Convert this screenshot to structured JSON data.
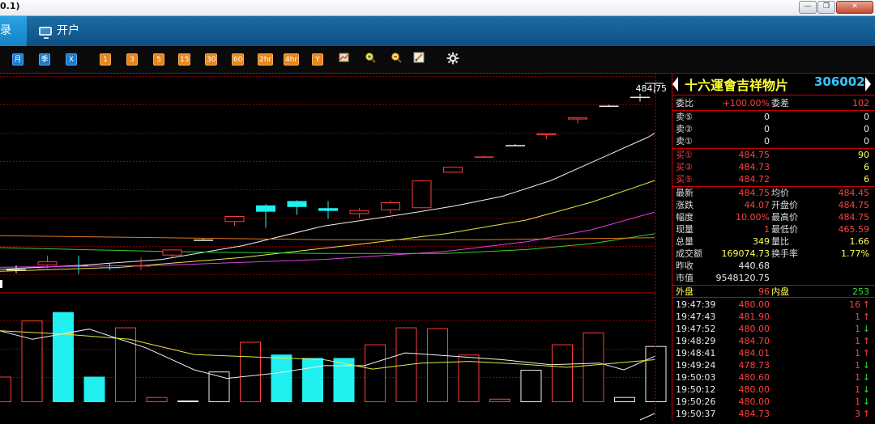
{
  "window": {
    "title_fragment": "0.1)",
    "minimize": "—",
    "restore": "❐",
    "close": "✕"
  },
  "tabs": [
    {
      "label": "录"
    },
    {
      "label": "开户"
    }
  ],
  "toolbar": {
    "period_buttons": [
      {
        "label": "月",
        "style": "blue"
      },
      {
        "label": "季",
        "style": "blue"
      },
      {
        "label": "X",
        "style": "blue"
      },
      {
        "label": "1",
        "style": "orange"
      },
      {
        "label": "3",
        "style": "orange"
      },
      {
        "label": "5",
        "style": "orange"
      },
      {
        "label": "15",
        "style": "orange"
      },
      {
        "label": "30",
        "style": "orange"
      },
      {
        "label": "60",
        "style": "orange"
      },
      {
        "label": "2hr",
        "style": "orange"
      },
      {
        "label": "4hr",
        "style": "orange"
      },
      {
        "label": "Y",
        "style": "orange"
      }
    ],
    "tool_icons": [
      "chart-edit-icon",
      "zoom-in-icon",
      "zoom-out-icon",
      "draw-pen-icon",
      "settings-gear-icon"
    ]
  },
  "stock": {
    "name": "十六運會吉祥物片",
    "code": "306002"
  },
  "quote": {
    "weibi_label": "委比",
    "weibi": "+100.00%",
    "weicha_label": "委差",
    "weicha": "102",
    "asks": [
      {
        "label": "卖⑤",
        "price": "0",
        "vol": "0"
      },
      {
        "label": "卖②",
        "price": "0",
        "vol": "0"
      },
      {
        "label": "卖①",
        "price": "0",
        "vol": "0"
      }
    ],
    "bids": [
      {
        "label": "买①",
        "price": "484.75",
        "vol": "90"
      },
      {
        "label": "买②",
        "price": "484.73",
        "vol": "6"
      },
      {
        "label": "买⑤",
        "price": "484.72",
        "vol": "6"
      }
    ],
    "stats": [
      {
        "l1": "最新",
        "v1": "484.75",
        "l2": "均价",
        "v2": "484.45"
      },
      {
        "l1": "涨跌",
        "v1": "44.07",
        "l2": "开盘价",
        "v2": "484.75"
      },
      {
        "l1": "幅度",
        "v1": "10.00%",
        "l2": "最高价",
        "v2": "484.75"
      },
      {
        "l1": "现量",
        "v1": "1",
        "l2": "最低价",
        "v2": "465.59"
      },
      {
        "l1": "总量",
        "v1": "349",
        "l2": "量比",
        "v2": "1.66"
      },
      {
        "l1": "成交额",
        "v1": "169074.73",
        "l2": "换手率",
        "v2": "1.77%"
      },
      {
        "l1": "昨收",
        "v1": "440.68",
        "l2": "",
        "v2": ""
      },
      {
        "l1": "市值",
        "v1": "9548120.75",
        "l2": "",
        "v2": ""
      }
    ],
    "waipan_label": "外盘",
    "waipan": "96",
    "neipan_label": "内盘",
    "neipan": "253"
  },
  "ticks": [
    {
      "time": "19:47:39",
      "price": "480.00",
      "vol": "16",
      "dir": "↑"
    },
    {
      "time": "19:47:43",
      "price": "481.90",
      "vol": "1",
      "dir": "↑"
    },
    {
      "time": "19:47:52",
      "price": "480.00",
      "vol": "1",
      "dir": "↓"
    },
    {
      "time": "19:48:29",
      "price": "484.70",
      "vol": "1",
      "dir": "↑"
    },
    {
      "time": "19:48:41",
      "price": "484.01",
      "vol": "1",
      "dir": "↑"
    },
    {
      "time": "19:49:24",
      "price": "478.73",
      "vol": "1",
      "dir": "↓"
    },
    {
      "time": "19:50:03",
      "price": "480.60",
      "vol": "1",
      "dir": "↓"
    },
    {
      "time": "19:50:12",
      "price": "480.00",
      "vol": "1",
      "dir": "↓"
    },
    {
      "time": "19:50:26",
      "price": "480.00",
      "vol": "1",
      "dir": "↓"
    },
    {
      "time": "19:50:37",
      "price": "484.73",
      "vol": "3",
      "dir": "↑"
    }
  ],
  "chart_data": {
    "type": "candlestick",
    "price_marker": "484.75",
    "candles": [
      {
        "o": 441,
        "h": 442,
        "l": 440,
        "c": 440.7,
        "color": "white"
      },
      {
        "o": 442,
        "h": 444.5,
        "l": 441.2,
        "c": 443,
        "color": "red"
      },
      {
        "o": 442,
        "h": 444.5,
        "l": 439.8,
        "c": 442,
        "color": "cyan"
      },
      {
        "o": 441.5,
        "h": 442.5,
        "l": 440.8,
        "c": 441.5,
        "color": "cyan"
      },
      {
        "o": 442,
        "h": 444,
        "l": 440.8,
        "c": 442,
        "color": "red"
      },
      {
        "o": 444.5,
        "h": 446,
        "l": 444,
        "c": 446,
        "color": "red"
      },
      {
        "o": 448.5,
        "h": 448.7,
        "l": 448.4,
        "c": 448.5,
        "color": "white"
      },
      {
        "o": 453,
        "h": 454,
        "l": 452,
        "c": 454.5,
        "color": "red"
      },
      {
        "o": 457.2,
        "h": 457.5,
        "l": 451.5,
        "c": 455.6,
        "color": "cyan"
      },
      {
        "o": 458.3,
        "h": 458.5,
        "l": 454.8,
        "c": 456.8,
        "color": "cyan"
      },
      {
        "o": 456.5,
        "h": 458.3,
        "l": 453.8,
        "c": 455.8,
        "color": "cyan"
      },
      {
        "o": 455,
        "h": 456.5,
        "l": 454,
        "c": 456,
        "color": "red"
      },
      {
        "o": 456,
        "h": 458.5,
        "l": 455,
        "c": 458,
        "color": "red"
      },
      {
        "o": 456.5,
        "h": 463.5,
        "l": 456.5,
        "c": 463.5,
        "color": "red"
      },
      {
        "o": 465.5,
        "h": 467,
        "l": 465.5,
        "c": 467,
        "color": "red"
      },
      {
        "o": 469.5,
        "h": 469.8,
        "l": 469.3,
        "c": 469.6,
        "color": "red"
      },
      {
        "o": 472.5,
        "h": 472.7,
        "l": 472.3,
        "c": 472.5,
        "color": "white"
      },
      {
        "o": 475,
        "h": 475.5,
        "l": 474,
        "c": 475.5,
        "color": "red"
      },
      {
        "o": 479,
        "h": 479.5,
        "l": 478,
        "c": 479.5,
        "color": "red"
      },
      {
        "o": 482.5,
        "h": 482.7,
        "l": 482.4,
        "c": 482.5,
        "color": "white"
      },
      {
        "o": 484.5,
        "h": 485.5,
        "l": 483.5,
        "c": 484.75,
        "color": "white"
      }
    ],
    "volumes": [
      {
        "v": 30,
        "color": "red"
      },
      {
        "v": 96,
        "color": "red"
      },
      {
        "v": 106,
        "color": "cyan"
      },
      {
        "v": 30,
        "color": "cyan"
      },
      {
        "v": 88,
        "color": "red"
      },
      {
        "v": 6,
        "color": "red"
      },
      {
        "v": 2,
        "color": "white"
      },
      {
        "v": 36,
        "color": "white"
      },
      {
        "v": 71,
        "color": "red"
      },
      {
        "v": 56,
        "color": "cyan"
      },
      {
        "v": 52,
        "color": "cyan"
      },
      {
        "v": 52,
        "color": "cyan"
      },
      {
        "v": 68,
        "color": "red"
      },
      {
        "v": 88,
        "color": "red"
      },
      {
        "v": 87,
        "color": "red"
      },
      {
        "v": 56,
        "color": "red"
      },
      {
        "v": 4,
        "color": "red"
      },
      {
        "v": 38,
        "color": "white"
      },
      {
        "v": 68,
        "color": "red"
      },
      {
        "v": 82,
        "color": "red"
      },
      {
        "v": 6,
        "color": "white"
      },
      {
        "v": 66,
        "color": "white"
      }
    ],
    "ma_lines": [
      {
        "color": "#f0f0f0",
        "points": [
          [
            0,
            441
          ],
          [
            100,
            442
          ],
          [
            200,
            443.5
          ],
          [
            300,
            447
          ],
          [
            400,
            452
          ],
          [
            500,
            455
          ],
          [
            560,
            457
          ],
          [
            620,
            459.5
          ],
          [
            680,
            463.5
          ],
          [
            740,
            469
          ],
          [
            800,
            474.5
          ],
          [
            808,
            475.5
          ]
        ]
      },
      {
        "color": "#e8e840",
        "points": [
          [
            0,
            440.5
          ],
          [
            150,
            441.5
          ],
          [
            300,
            444
          ],
          [
            450,
            447.5
          ],
          [
            550,
            450
          ],
          [
            650,
            453.5
          ],
          [
            730,
            458
          ],
          [
            808,
            463.5
          ]
        ]
      },
      {
        "color": "#e040e0",
        "points": [
          [
            0,
            441.5
          ],
          [
            200,
            442
          ],
          [
            400,
            443.5
          ],
          [
            550,
            445.5
          ],
          [
            650,
            448
          ],
          [
            730,
            451
          ],
          [
            808,
            455.5
          ]
        ]
      },
      {
        "color": "#30d030",
        "points": [
          [
            0,
            446.5
          ],
          [
            200,
            445.5
          ],
          [
            400,
            445
          ],
          [
            550,
            445
          ],
          [
            650,
            446
          ],
          [
            730,
            447.5
          ],
          [
            808,
            450
          ]
        ]
      },
      {
        "color": "#e07a20",
        "points": [
          [
            0,
            449.5
          ],
          [
            200,
            449
          ],
          [
            400,
            448.5
          ],
          [
            600,
            448.5
          ],
          [
            808,
            449
          ]
        ]
      }
    ],
    "vol_lines": [
      {
        "color": "#f0f0f0",
        "points": [
          [
            0,
            84
          ],
          [
            40,
            74
          ],
          [
            110,
            86
          ],
          [
            180,
            64
          ],
          [
            240,
            38
          ],
          [
            280,
            28
          ],
          [
            340,
            34
          ],
          [
            400,
            43
          ],
          [
            450,
            43
          ],
          [
            500,
            58
          ],
          [
            560,
            54
          ],
          [
            620,
            50
          ],
          [
            680,
            44
          ],
          [
            740,
            46
          ],
          [
            770,
            38
          ],
          [
            808,
            54
          ]
        ]
      },
      {
        "color": "#e8e840",
        "points": [
          [
            0,
            84
          ],
          [
            80,
            80
          ],
          [
            160,
            74
          ],
          [
            240,
            56
          ],
          [
            320,
            53
          ],
          [
            400,
            50
          ],
          [
            460,
            39
          ],
          [
            520,
            46
          ],
          [
            580,
            48
          ],
          [
            640,
            45
          ],
          [
            700,
            41
          ],
          [
            760,
            46
          ],
          [
            808,
            50
          ]
        ]
      }
    ]
  }
}
